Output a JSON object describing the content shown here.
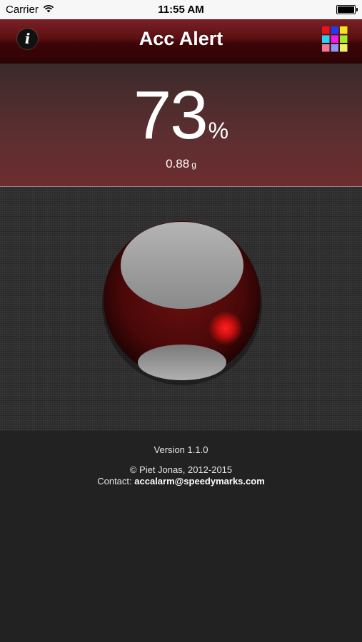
{
  "status_bar": {
    "carrier": "Carrier",
    "time": "11:55 AM",
    "wifi_icon": "wifi-icon",
    "battery_icon": "battery-icon"
  },
  "navbar": {
    "title": "Acc Alert",
    "info_label": "i",
    "grid_icon": "color-grid-icon",
    "grid_colors": [
      "#e6141e",
      "#1e3cf0",
      "#f0e61e",
      "#28d2f0",
      "#e61ee6",
      "#a0f028",
      "#f07896",
      "#8c96f0",
      "#f0f064"
    ]
  },
  "reading": {
    "percent_value": "73",
    "percent_unit": "%",
    "g_value": "0.88",
    "g_unit": "g"
  },
  "indicator": {
    "icon": "alert-ball-icon",
    "ball_color": "#5a0a0a",
    "light_color": "#e01010"
  },
  "footer": {
    "version": "Version 1.1.0",
    "copyright": "© Piet Jonas, 2012-2015",
    "contact_label": "Contact: ",
    "contact_email": "accalarm@speedymarks.com"
  }
}
